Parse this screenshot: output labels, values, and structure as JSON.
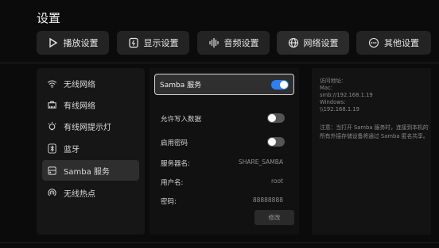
{
  "title": "设置",
  "tabs": [
    {
      "label": "播放设置",
      "icon": "play-icon"
    },
    {
      "label": "显示设置",
      "icon": "display-icon"
    },
    {
      "label": "音频设置",
      "icon": "audio-wave-icon"
    },
    {
      "label": "网络设置",
      "icon": "globe-icon",
      "selected": true
    },
    {
      "label": "其他设置",
      "icon": "more-icon"
    }
  ],
  "sidebar": {
    "items": [
      {
        "label": "无线网络",
        "icon": "wifi-icon"
      },
      {
        "label": "有线网络",
        "icon": "ethernet-icon"
      },
      {
        "label": "有线网提示灯",
        "icon": "light-bulb-icon"
      },
      {
        "label": "蓝牙",
        "icon": "bluetooth-icon"
      },
      {
        "label": "Samba 服务",
        "icon": "samba-icon",
        "selected": true
      },
      {
        "label": "无线热点",
        "icon": "hotspot-icon"
      }
    ]
  },
  "samba": {
    "label": "Samba 服务",
    "enabled": true,
    "allow_write_label": "允许写入数据",
    "allow_write": false,
    "password_enable_label": "启用密码",
    "password_enabled": false,
    "server_name_label": "服务器名:",
    "server_name": "SHARE_SAMBA",
    "username_label": "用户名:",
    "username": "root",
    "password_label": "密码:",
    "password": "88888888",
    "modify_label": "修改"
  },
  "info": {
    "access": "访问地址:\nMac:\nsmb://192.168.1.19\nWindows:\n\\\\192.168.1.19",
    "note": "注意：当打开 Samba 服务时，连接到本机的所有外接存储设备将通过 Samba 匿名共享。"
  },
  "colors": {
    "accent": "#2f80ed",
    "background": "#0b0b0b"
  }
}
